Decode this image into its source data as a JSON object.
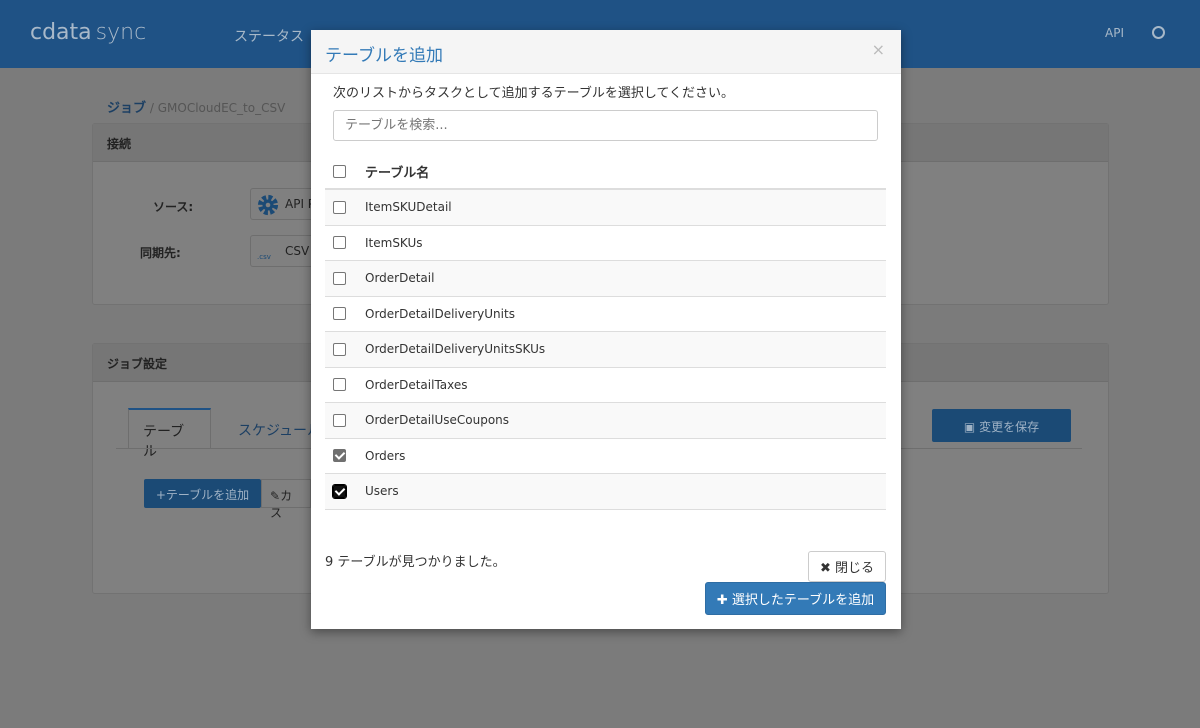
{
  "app": {
    "logo": "cdata",
    "logo_sync": "sync",
    "nav_status": "ステータス",
    "api": "API"
  },
  "breadcrumb": {
    "root": "ジョブ",
    "sep": "/",
    "current": "GMOCloudEC_to_CSV"
  },
  "connection": {
    "title": "接続",
    "source_label": "ソース:",
    "source_value": "API P",
    "dest_label": "同期先:",
    "dest_value": "CSV"
  },
  "job_settings": {
    "title": "ジョブ設定",
    "tabs": [
      "テーブル",
      "スケジュール"
    ],
    "add_table": "+テーブルを追加",
    "custom": "カス",
    "save": "変更を保存"
  },
  "modal": {
    "title": "テーブルを追加",
    "close_x": "×",
    "description": "次のリストからタスクとして追加するテーブルを選択してください。",
    "search_placeholder": "テーブルを検索...",
    "column_header": "テーブル名",
    "rows": [
      {
        "name": "ItemSKUDetail",
        "checked": false
      },
      {
        "name": "ItemSKUs",
        "checked": false
      },
      {
        "name": "OrderDetail",
        "checked": false
      },
      {
        "name": "OrderDetailDeliveryUnits",
        "checked": false
      },
      {
        "name": "OrderDetailDeliveryUnitsSKUs",
        "checked": false
      },
      {
        "name": "OrderDetailTaxes",
        "checked": false
      },
      {
        "name": "OrderDetailUseCoupons",
        "checked": false
      },
      {
        "name": "Orders",
        "checked": true
      },
      {
        "name": "Users",
        "checked": true
      }
    ],
    "found": "9 テーブルが見つかりました。",
    "close_button": "✖ 閉じる",
    "add_selected_button": "✚ 選択したテーブルを追加"
  },
  "colors": {
    "header": "#1f5285",
    "accent": "#337ab7"
  }
}
